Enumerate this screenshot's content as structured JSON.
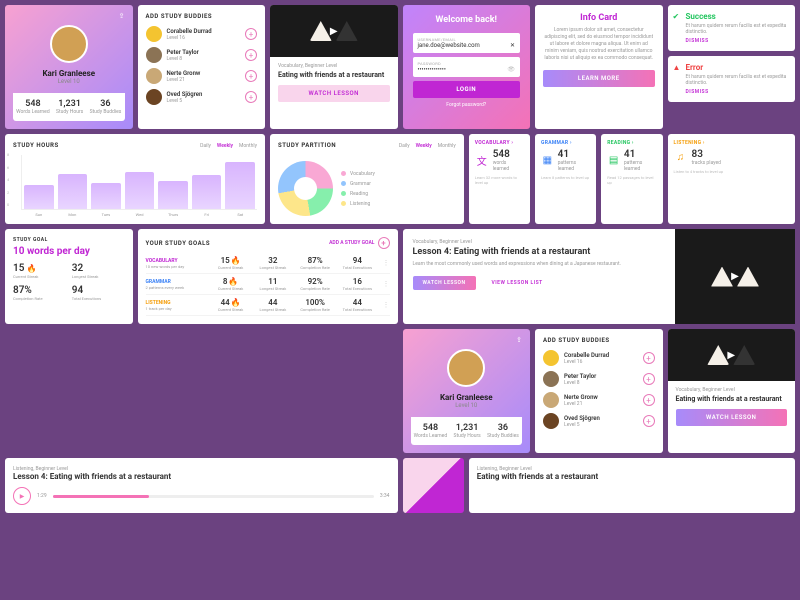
{
  "profile": {
    "name": "Kari Granleese",
    "level": "Level 10",
    "stats": [
      {
        "num": "548",
        "lbl": "Words Learned"
      },
      {
        "num": "1,231",
        "lbl": "Study Hours"
      },
      {
        "num": "36",
        "lbl": "Study Buddies"
      }
    ]
  },
  "buddies": {
    "heading": "ADD STUDY BUDDIES",
    "items": [
      {
        "name": "Corabelle Durrad",
        "level": "Level 16",
        "color": "#f4c430"
      },
      {
        "name": "Peter Taylor",
        "level": "Level 8",
        "color": "#8b7355"
      },
      {
        "name": "Nerte Gronw",
        "level": "Level 21",
        "color": "#c9a876"
      },
      {
        "name": "Oved Sjögren",
        "level": "Level 5",
        "color": "#6b4423"
      }
    ]
  },
  "lesson": {
    "category": "Vocabulary, Beginner Level",
    "title": "Eating with friends at a restaurant",
    "watch": "WATCH LESSON"
  },
  "welcome": {
    "title": "Welcome back!",
    "user_lbl": "USERNAME/EMAIL",
    "user_val": "jane.doe@website.com",
    "pass_lbl": "PASSWORD",
    "pass_val": "••••••••••••••",
    "login": "LOGIN",
    "forgot": "Forgot password?"
  },
  "info": {
    "title": "Info Card",
    "text": "Lorem ipsum dolor sit amet, consectetur adipiscing elit, sed do eiusmod tempor incididunt ut labore et dolore magna aliqua. Ut enim ad minim veniam, quis nostrud exercitation ullamco laboris nisi ut aliquip ex ea commodo consequat.",
    "btn": "LEARN MORE"
  },
  "alerts": {
    "success": {
      "title": "Success",
      "text": "Et harum quidem rerum facilis est et expedita distinctio.",
      "dismiss": "DISMISS"
    },
    "error": {
      "title": "Error",
      "text": "Et harum quidem rerum facilis est et expedita distinctio.",
      "dismiss": "DISMISS"
    }
  },
  "hours": {
    "title": "STUDY HOURS",
    "tabs": [
      "Daily",
      "Weekly",
      "Monthly"
    ],
    "active": "Weekly"
  },
  "partition": {
    "title": "STUDY PARTITION",
    "legend": [
      {
        "lbl": "Vocabulary",
        "c": "#f9a8d4"
      },
      {
        "lbl": "Grammar",
        "c": "#93c5fd"
      },
      {
        "lbl": "Reading",
        "c": "#86efac"
      },
      {
        "lbl": "Listening",
        "c": "#fde68a"
      }
    ]
  },
  "stat_cards": [
    {
      "cat": "VOCABULARY",
      "cls": "svoc",
      "ico": "文",
      "num": "548",
      "lbl": "words learned",
      "note": "Learn 32 more words to level up"
    },
    {
      "cat": "GRAMMAR",
      "cls": "sgra",
      "ico": "▦",
      "num": "41",
      "lbl": "patterns learned",
      "note": "Learn 8 patterns to level up"
    },
    {
      "cat": "READING",
      "cls": "srea",
      "ico": "▤",
      "num": "41",
      "lbl": "patterns learned",
      "note": "Read 12 passages to level up"
    },
    {
      "cat": "LISTENING",
      "cls": "slis",
      "ico": "♫",
      "num": "83",
      "lbl": "tracks played",
      "note": "Listen to 4 tracks to level up"
    }
  ],
  "wlesson": {
    "category": "Vocabulary, Beginner Level",
    "title": "Lesson 4: Eating with friends at a restaurant",
    "desc": "Learn the most commonly used words and expressions when dining at a Japanese restaurant.",
    "watch": "WATCH LESSON",
    "list": "VIEW LESSON LIST"
  },
  "goal": {
    "title": "STUDY GOAL",
    "val": "10 words per day",
    "stats": [
      {
        "n": "15",
        "fire": true,
        "l": "Current Streak"
      },
      {
        "n": "32",
        "l": "Longest Streak"
      },
      {
        "n": "87%",
        "l": "Completion Rate"
      },
      {
        "n": "94",
        "l": "Total Executions"
      }
    ]
  },
  "ygoals": {
    "title": "YOUR STUDY GOALS",
    "add": "ADD A STUDY GOAL",
    "rows": [
      {
        "cat": "VOCABULARY",
        "cls": "svoc",
        "desc": "10 new words per day",
        "cells": [
          {
            "n": "15",
            "fire": true,
            "l": "Current Streak"
          },
          {
            "n": "32",
            "l": "Longest Streak"
          },
          {
            "n": "87%",
            "l": "Completion Rate"
          },
          {
            "n": "94",
            "l": "Total Executions"
          }
        ]
      },
      {
        "cat": "GRAMMAR",
        "cls": "sgra",
        "desc": "2 patterns every week",
        "cells": [
          {
            "n": "8",
            "fire": true,
            "l": "Current Streak"
          },
          {
            "n": "11",
            "l": "Longest Streak"
          },
          {
            "n": "92%",
            "l": "Completion Rate"
          },
          {
            "n": "16",
            "l": "Total Executions"
          }
        ]
      },
      {
        "cat": "LISTENING",
        "cls": "slis",
        "desc": "1 track per day",
        "cells": [
          {
            "n": "44",
            "fire": true,
            "l": "Current Streak"
          },
          {
            "n": "44",
            "l": "Longest Streak"
          },
          {
            "n": "100%",
            "l": "Completion Rate"
          },
          {
            "n": "44",
            "l": "Total Executions"
          }
        ]
      }
    ]
  },
  "audio": {
    "category": "Listening, Beginner Level",
    "title": "Lesson 4: Eating with friends at a restaurant",
    "cur": "1:29",
    "total": "3:34"
  },
  "listening_bar": {
    "category": "Listening, Beginner Level",
    "title": "Eating with friends at a restaurant"
  },
  "chart_data": {
    "type": "bar",
    "categories": [
      "Sun",
      "Mon",
      "Tues",
      "Wed",
      "Thurs",
      "Fri",
      "Sat"
    ],
    "values": [
      3.5,
      5.2,
      3.8,
      5.5,
      4.2,
      5.0,
      7.0
    ],
    "ylim": [
      0,
      8
    ],
    "ylabel": "",
    "xlabel": ""
  }
}
